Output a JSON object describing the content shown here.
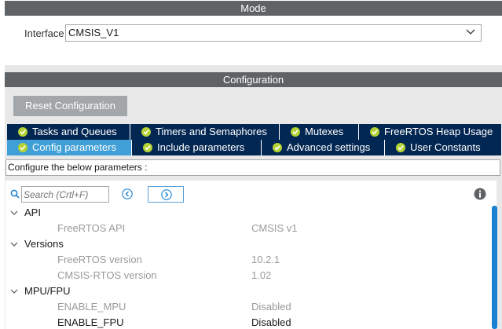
{
  "mode": {
    "title": "Mode",
    "interface_label": "Interface",
    "interface_value": "CMSIS_V1"
  },
  "configuration": {
    "title": "Configuration",
    "reset_button": "Reset Configuration",
    "tabs_row1": [
      {
        "label": "Tasks and Queues"
      },
      {
        "label": "Timers and Semaphores"
      },
      {
        "label": "Mutexes"
      },
      {
        "label": "FreeRTOS Heap Usage"
      }
    ],
    "tabs_row2": [
      {
        "label": "Config parameters",
        "active": true
      },
      {
        "label": "Include parameters"
      },
      {
        "label": "Advanced settings"
      },
      {
        "label": "User Constants"
      }
    ],
    "description": "Configure the below parameters :",
    "search_placeholder": "Search (Crtl+F)",
    "tree": [
      {
        "group": "API",
        "params": [
          {
            "name": "FreeRTOS API",
            "value": "CMSIS v1"
          }
        ]
      },
      {
        "group": "Versions",
        "params": [
          {
            "name": "FreeRTOS version",
            "value": "10.2.1"
          },
          {
            "name": "CMSIS-RTOS version",
            "value": "1.02"
          }
        ]
      },
      {
        "group": "MPU/FPU",
        "params": [
          {
            "name": "ENABLE_MPU",
            "value": "Disabled"
          },
          {
            "name": "ENABLE_FPU",
            "value": "Disabled"
          }
        ]
      }
    ]
  },
  "colors": {
    "section_bar": "#5f6366",
    "tab_bg": "#032753",
    "tab_active": "#3f9fd6",
    "check_green": "#b5d334",
    "scrollbar": "#1a80d0"
  }
}
